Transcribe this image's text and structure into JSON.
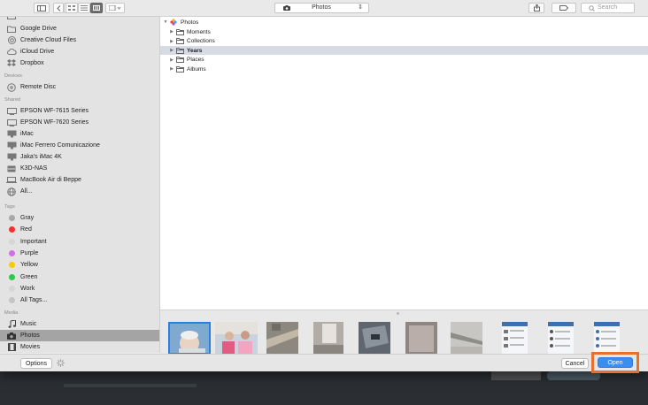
{
  "toolbar": {
    "location": "Photos",
    "search_placeholder": "Search"
  },
  "sidebar": {
    "top_items": [
      {
        "label": "Google Drive",
        "icon": "folder-icon"
      },
      {
        "label": "Creative Cloud Files",
        "icon": "creative-cloud-icon"
      },
      {
        "label": "iCloud Drive",
        "icon": "cloud-icon"
      },
      {
        "label": "Dropbox",
        "icon": "dropbox-icon"
      }
    ],
    "devices_header": "Devices",
    "devices": [
      {
        "label": "Remote Disc",
        "icon": "disc-icon"
      }
    ],
    "shared_header": "Shared",
    "shared": [
      {
        "label": "EPSON WF-7615 Series",
        "icon": "display-icon"
      },
      {
        "label": "EPSON WF-7620 Series",
        "icon": "display-icon"
      },
      {
        "label": "iMac",
        "icon": "imac-icon"
      },
      {
        "label": "iMac Ferrero Comunicazione",
        "icon": "imac-icon"
      },
      {
        "label": "Jaka's iMac 4K",
        "icon": "imac-icon"
      },
      {
        "label": "K3D-NAS",
        "icon": "nas-icon"
      },
      {
        "label": "MacBook Air di Beppe",
        "icon": "laptop-icon"
      },
      {
        "label": "All...",
        "icon": "globe-icon"
      }
    ],
    "tags_header": "Tags",
    "tags": [
      {
        "label": "Gray",
        "color": "#a8a8a8"
      },
      {
        "label": "Red",
        "color": "#f2312e"
      },
      {
        "label": "Important",
        "color": "#d6d6d6"
      },
      {
        "label": "Purple",
        "color": "#cf72e6"
      },
      {
        "label": "Yellow",
        "color": "#f7c90b"
      },
      {
        "label": "Green",
        "color": "#2fc94a"
      },
      {
        "label": "Work",
        "color": "#d6d6d6"
      },
      {
        "label": "All Tags...",
        "color": "#c4c4c4"
      }
    ],
    "media_header": "Media",
    "media": [
      {
        "label": "Music",
        "icon": "music-note-icon"
      },
      {
        "label": "Photos",
        "icon": "camera-icon",
        "selected": true
      },
      {
        "label": "Movies",
        "icon": "film-icon"
      }
    ]
  },
  "tree": {
    "root": "Photos",
    "children": [
      {
        "label": "Moments"
      },
      {
        "label": "Collections"
      },
      {
        "label": "Years",
        "selected": true
      },
      {
        "label": "Places"
      },
      {
        "label": "Albums"
      }
    ]
  },
  "footer": {
    "options_label": "Options",
    "cancel_label": "Cancel",
    "open_label": "Open"
  },
  "colors": {
    "accent": "#3b8df0",
    "highlight_box": "#e8702e",
    "selection": "#d6dbe6"
  }
}
